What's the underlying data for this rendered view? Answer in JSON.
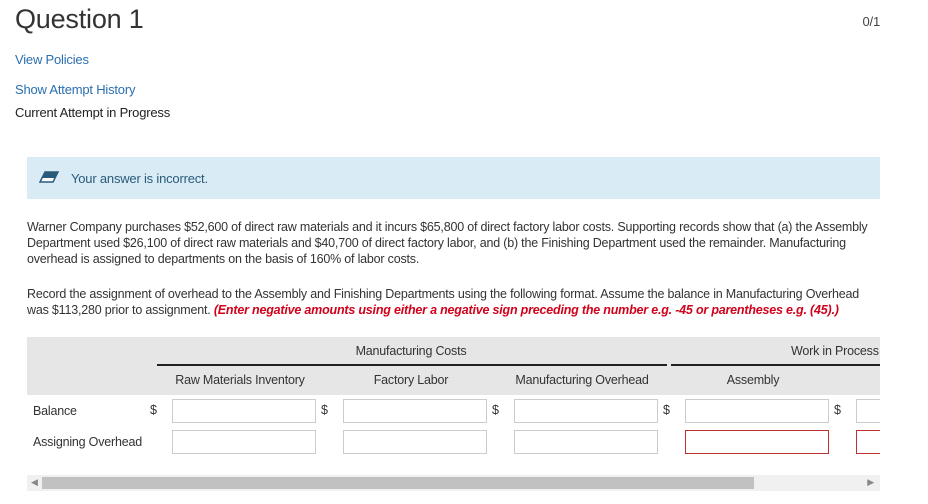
{
  "header": {
    "title": "Question 1",
    "score": "0/1",
    "view_policies": "View Policies",
    "show_attempt_history": "Show Attempt History",
    "current_attempt": "Current Attempt in Progress"
  },
  "feedback": {
    "icon": "eraser-icon",
    "text": "Your answer is incorrect.",
    "color": "#d9ecf5"
  },
  "problem": {
    "p1": "Warner Company purchases $52,600 of direct raw materials and it incurs $65,800 of direct factory labor costs. Supporting records show that (a) the Assembly Department used $26,100 of direct raw materials and $40,700 of direct factory labor, and (b) the Finishing Department used the remainder. Manufacturing overhead is assigned to departments on the basis of 160% of labor costs.",
    "p2": "Record the assignment of overhead to the Assembly and Finishing Departments using the following format. Assume the balance in Manufacturing Overhead was $113,280 prior to assignment. ",
    "warning": "(Enter negative amounts using either a negative sign preceding the number e.g. -45 or parentheses e.g. (45).)"
  },
  "table": {
    "group1": "Manufacturing Costs",
    "group2": "Work in Process",
    "columns": [
      "Raw Materials Inventory",
      "Factory Labor",
      "Manufacturing Overhead",
      "Assembly"
    ],
    "rows": [
      {
        "label": "Balance",
        "currency": "$"
      },
      {
        "label": "Assigning Overhead"
      }
    ]
  }
}
